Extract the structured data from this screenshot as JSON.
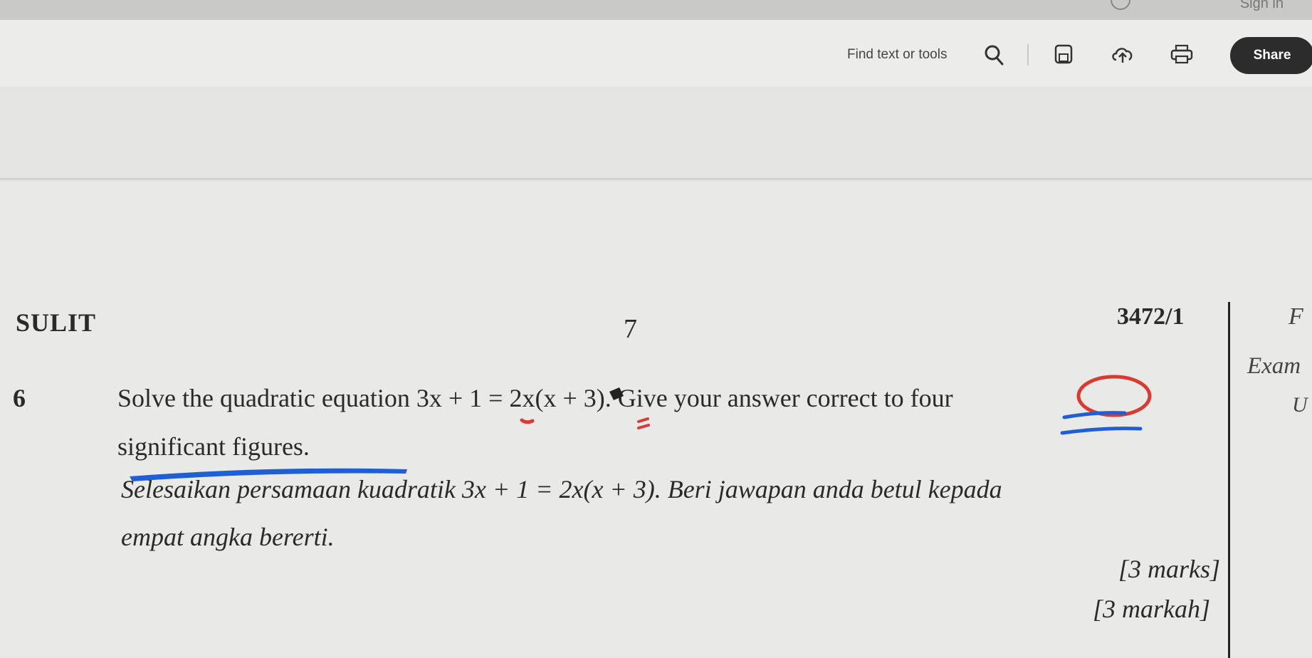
{
  "top_bar": {
    "sign_in_label": "Sign in"
  },
  "toolbar": {
    "find_label": "Find text or tools",
    "share_label": "Share",
    "icons": [
      "search-icon",
      "save-icon",
      "upload-cloud-icon",
      "print-icon"
    ]
  },
  "document": {
    "header_left": "SULIT",
    "page_number": "7",
    "paper_code": "3472/1",
    "margin_text_1": "F",
    "margin_text_2": "Exam",
    "margin_text_3": "U",
    "question_number": "6",
    "question_en_line1": "Solve the quadratic equation 3x + 1 = 2x(x + 3). Give your answer correct to four",
    "question_en_line2": "significant figures.",
    "question_ms_line1": "Selesaikan persamaan kuadratik 3x + 1 = 2x(x + 3). Beri jawapan anda betul kepada",
    "question_ms_line2": "empat angka bererti.",
    "marks_en": "[3 marks]",
    "marks_ms": "[3 markah]"
  },
  "colors": {
    "share_button": "#2c2c2c",
    "pen_blue": "#1f5fd6",
    "pen_red": "#d93a34",
    "page_background": "#e9eae7"
  }
}
